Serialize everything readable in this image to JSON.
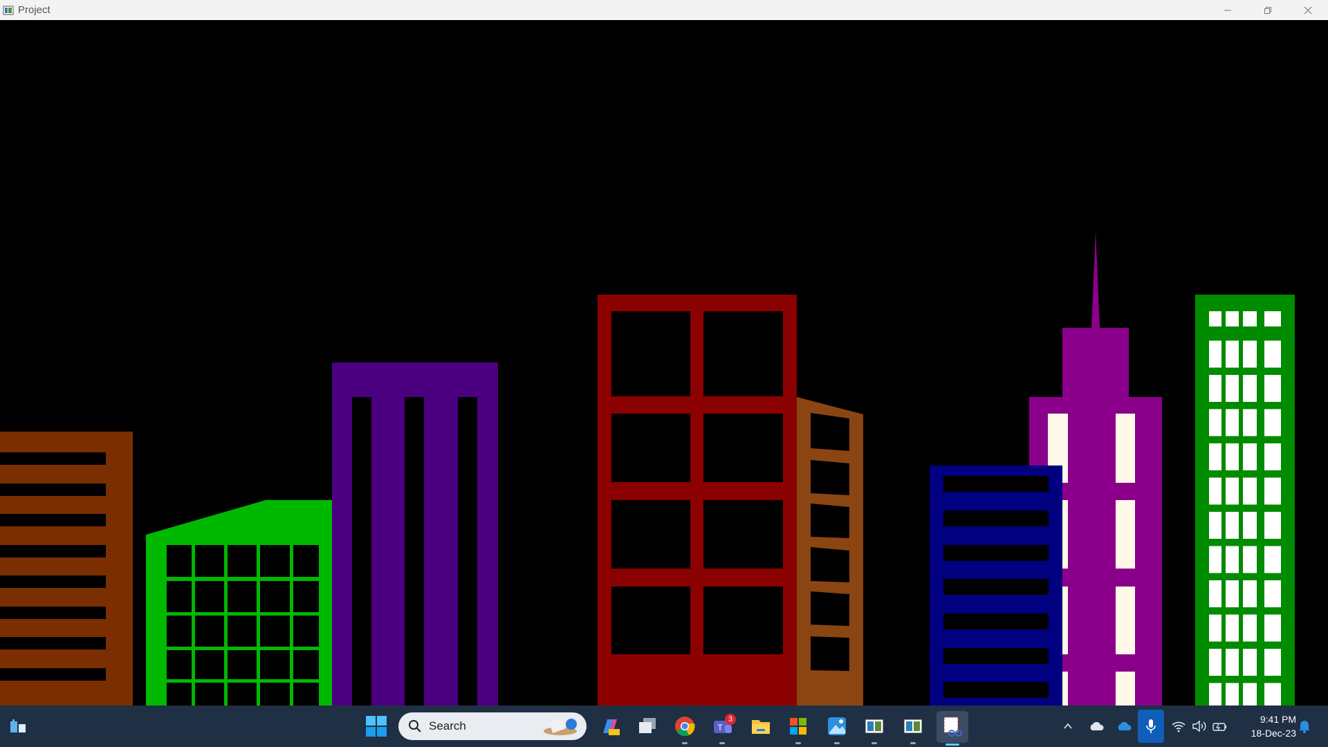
{
  "window": {
    "title": "Project",
    "controls": [
      "minimize-icon",
      "restore-icon",
      "close-icon"
    ]
  },
  "scene": {
    "background": "#000000",
    "buildings": [
      {
        "name": "building-brown-left",
        "color": "#7b2e00",
        "window_color": "#000000"
      },
      {
        "name": "building-green-grid",
        "color": "#00b800",
        "window_color": "#000000"
      },
      {
        "name": "building-purple-columns",
        "color": "#4b0080",
        "window_color": "#000000"
      },
      {
        "name": "building-red-tower",
        "color": "#8b0000",
        "window_color": "#000000"
      },
      {
        "name": "building-orange-side",
        "color": "#8b4513",
        "window_color": "#000000"
      },
      {
        "name": "building-navy",
        "color": "#000080",
        "window_color": "#000000"
      },
      {
        "name": "building-magenta-spire",
        "color": "#8b008b",
        "window_color": "#fff8e8"
      },
      {
        "name": "building-green-tall",
        "color": "#008b00",
        "window_color": "#ffffff"
      }
    ]
  },
  "taskbar": {
    "search_placeholder": "Search",
    "teams_badge": "3",
    "apps": [
      "widgets-icon",
      "start-icon",
      "copilot-icon",
      "task-view-icon",
      "chrome-icon",
      "teams-icon",
      "file-explorer-icon",
      "store-icon",
      "photos-icon",
      "project-window-icon",
      "project-window-2-icon",
      "snipping-tool-icon"
    ],
    "tray_icons": [
      "chevron-up-icon",
      "cloud-icon",
      "onedrive-icon",
      "microphone-icon",
      "wifi-icon",
      "volume-icon",
      "battery-icon",
      "notification-icon"
    ],
    "time": "9:41 PM",
    "date": "18-Dec-23"
  }
}
